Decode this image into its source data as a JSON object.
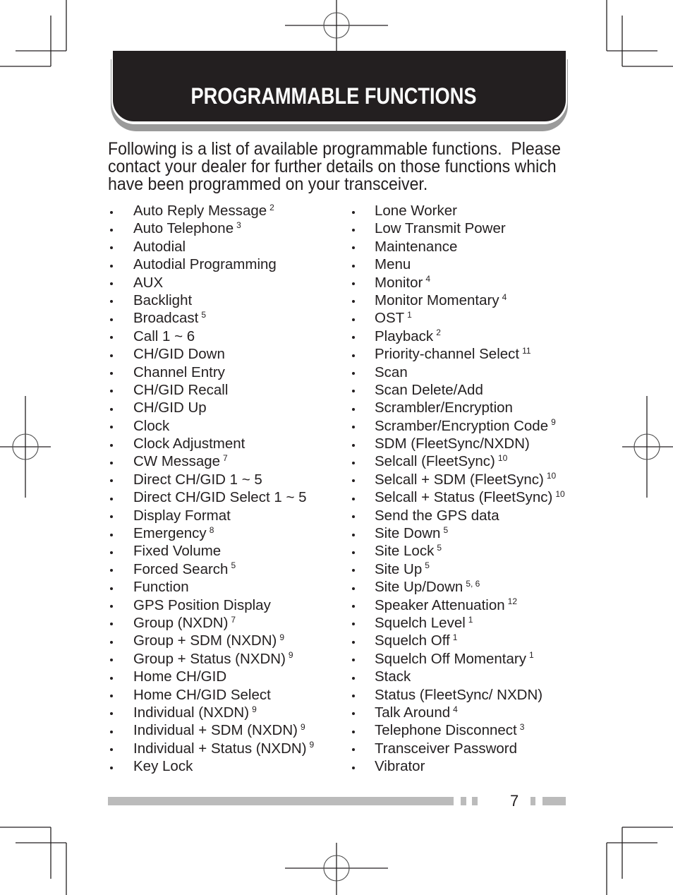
{
  "header": {
    "title": "PROGRAMMABLE FUNCTIONS"
  },
  "intro": {
    "lines": [
      "Following is a list of available programmable functions.  Please",
      "contact your dealer for further details on those functions which",
      "have been programmed on your transceiver."
    ]
  },
  "functions": {
    "left": [
      {
        "label": "Auto Reply Message",
        "note": "2"
      },
      {
        "label": "Auto Telephone",
        "note": "3"
      },
      {
        "label": "Autodial",
        "note": ""
      },
      {
        "label": "Autodial Programming",
        "note": ""
      },
      {
        "label": "AUX",
        "note": ""
      },
      {
        "label": "Backlight",
        "note": ""
      },
      {
        "label": "Broadcast",
        "note": "5"
      },
      {
        "label": "Call 1 ~ 6",
        "note": ""
      },
      {
        "label": "CH/GID Down",
        "note": ""
      },
      {
        "label": "Channel Entry",
        "note": ""
      },
      {
        "label": "CH/GID Recall",
        "note": ""
      },
      {
        "label": "CH/GID Up",
        "note": ""
      },
      {
        "label": "Clock",
        "note": ""
      },
      {
        "label": "Clock Adjustment",
        "note": ""
      },
      {
        "label": "CW Message",
        "note": "7"
      },
      {
        "label": "Direct CH/GID 1 ~ 5",
        "note": ""
      },
      {
        "label": "Direct CH/GID Select 1 ~ 5",
        "note": ""
      },
      {
        "label": "Display Format",
        "note": ""
      },
      {
        "label": "Emergency",
        "note": "8"
      },
      {
        "label": "Fixed Volume",
        "note": ""
      },
      {
        "label": "Forced Search",
        "note": "5"
      },
      {
        "label": "Function",
        "note": ""
      },
      {
        "label": "GPS Position Display",
        "note": ""
      },
      {
        "label": "Group (NXDN)",
        "note": "7"
      },
      {
        "label": "Group + SDM (NXDN)",
        "note": "9"
      },
      {
        "label": "Group + Status (NXDN)",
        "note": "9"
      },
      {
        "label": "Home CH/GID",
        "note": ""
      },
      {
        "label": "Home CH/GID Select",
        "note": ""
      },
      {
        "label": "Individual (NXDN)",
        "note": "9"
      },
      {
        "label": "Individual + SDM (NXDN)",
        "note": "9"
      },
      {
        "label": "Individual + Status (NXDN)",
        "note": "9"
      },
      {
        "label": "Key Lock",
        "note": ""
      }
    ],
    "right": [
      {
        "label": "Lone Worker",
        "note": ""
      },
      {
        "label": "Low Transmit Power",
        "note": ""
      },
      {
        "label": "Maintenance",
        "note": ""
      },
      {
        "label": "Menu",
        "note": ""
      },
      {
        "label": "Monitor",
        "note": "4"
      },
      {
        "label": "Monitor Momentary",
        "note": "4"
      },
      {
        "label": "OST",
        "note": "1"
      },
      {
        "label": "Playback",
        "note": "2"
      },
      {
        "label": "Priority-channel Select",
        "note": "11"
      },
      {
        "label": "Scan",
        "note": ""
      },
      {
        "label": "Scan Delete/Add",
        "note": ""
      },
      {
        "label": "Scrambler/Encryption",
        "note": ""
      },
      {
        "label": "Scramber/Encryption Code",
        "note": "9"
      },
      {
        "label": "SDM (FleetSync/NXDN)",
        "note": ""
      },
      {
        "label": "Selcall (FleetSync)",
        "note": "10"
      },
      {
        "label": "Selcall + SDM (FleetSync)",
        "note": "10"
      },
      {
        "label": "Selcall + Status (FleetSync)",
        "note": "10"
      },
      {
        "label": "Send the GPS data",
        "note": ""
      },
      {
        "label": "Site Down",
        "note": "5"
      },
      {
        "label": "Site Lock",
        "note": "5"
      },
      {
        "label": "Site Up",
        "note": "5"
      },
      {
        "label": "Site Up/Down",
        "note": "5, 6"
      },
      {
        "label": "Speaker Attenuation",
        "note": "12"
      },
      {
        "label": "Squelch Level",
        "note": "1"
      },
      {
        "label": "Squelch Off",
        "note": "1"
      },
      {
        "label": "Squelch Off Momentary",
        "note": "1"
      },
      {
        "label": "Stack",
        "note": ""
      },
      {
        "label": "Status (FleetSync/ NXDN)",
        "note": ""
      },
      {
        "label": "Talk Around",
        "note": "4"
      },
      {
        "label": "Telephone Disconnect",
        "note": "3"
      },
      {
        "label": "Transceiver Password",
        "note": ""
      },
      {
        "label": "Vibrator",
        "note": ""
      }
    ]
  },
  "footer": {
    "page_number": "7"
  },
  "colors": {
    "ink": "#231f20",
    "banner": "#231f20",
    "banner_shadow": "#9a9a9a",
    "footer_bar": "#bbbbbb"
  }
}
